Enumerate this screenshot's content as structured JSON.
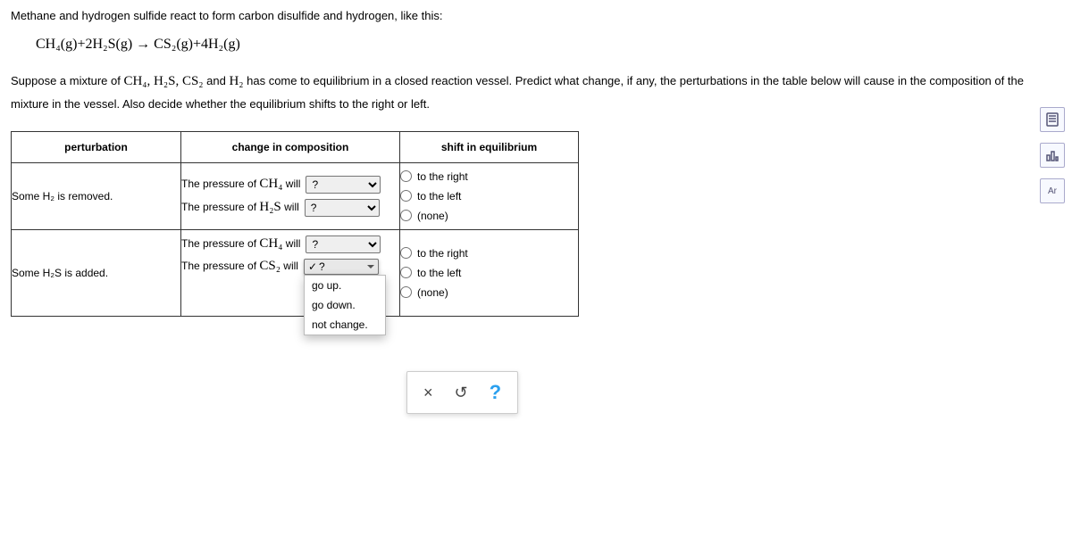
{
  "intro": {
    "line1": "Methane and hydrogen sulfide react to form carbon disulfide and hydrogen, like this:",
    "formula_lhs": "CH₄(g)+2H₂S(g)",
    "formula_arrow": "→",
    "formula_rhs": "CS₂(g)+4H₂(g)"
  },
  "problem": {
    "part1": "Suppose a mixture of ",
    "chems": "CH₄, H₂S, CS₂",
    "part_and": " and ",
    "chem_h2": "H₂",
    "part2": " has come to equilibrium in a closed reaction vessel. Predict what change, if any, the perturbations in the table below will cause in the composition of the mixture in the vessel. Also decide whether the equilibrium shifts to the right or left."
  },
  "headers": {
    "perturbation": "perturbation",
    "change": "change in composition",
    "shift": "shift in equilibrium"
  },
  "rows": [
    {
      "perturbation": "Some H₂ is removed.",
      "change_label1_pre": "The pressure of ",
      "change_label1_chem": "CH₄",
      "change_label1_post": " will",
      "change_label2_pre": "The pressure of ",
      "change_label2_chem": "H₂S",
      "change_label2_post": " will"
    },
    {
      "perturbation": "Some H₂S is added.",
      "change_label1_pre": "The pressure of ",
      "change_label1_chem": "CH₄",
      "change_label1_post": " will",
      "change_label2_pre": "The pressure of ",
      "change_label2_chem": "CS₂",
      "change_label2_post": " will"
    }
  ],
  "select": {
    "placeholder": "?",
    "options": [
      "?",
      "go up.",
      "go down.",
      "not change."
    ]
  },
  "shift_options": {
    "right": "to the right",
    "left": "to the left",
    "none": "(none)"
  },
  "bottom": {
    "close": "×",
    "reset": "↺",
    "help": "?"
  },
  "sidetools": {
    "calc": "calculator",
    "bars": "bars",
    "ar": "Ar"
  }
}
